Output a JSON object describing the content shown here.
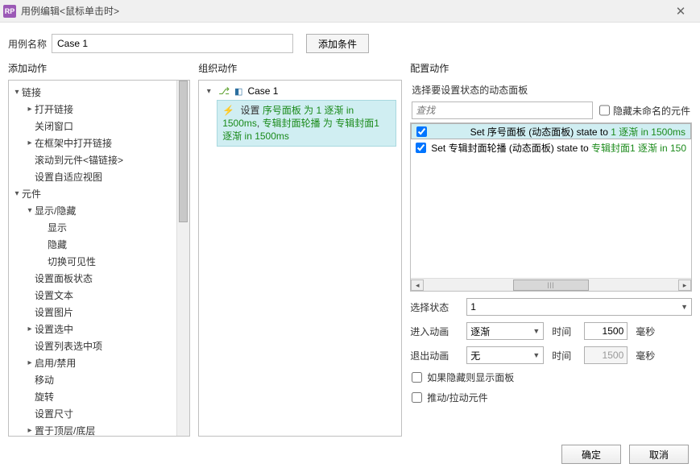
{
  "window": {
    "title": "用例编辑<鼠标单击时>"
  },
  "top": {
    "label": "用例名称",
    "case_name": "Case 1",
    "add_condition": "添加条件"
  },
  "columns": {
    "left": "添加动作",
    "mid": "组织动作",
    "right": "配置动作"
  },
  "tree": [
    {
      "level": 0,
      "arrow": "down",
      "label": "链接"
    },
    {
      "level": 1,
      "arrow": "right",
      "label": "打开链接"
    },
    {
      "level": 1,
      "arrow": "",
      "label": "关闭窗口"
    },
    {
      "level": 1,
      "arrow": "right",
      "label": "在框架中打开链接"
    },
    {
      "level": 1,
      "arrow": "",
      "label": "滚动到元件<锚链接>"
    },
    {
      "level": 1,
      "arrow": "",
      "label": "设置自适应视图"
    },
    {
      "level": 0,
      "arrow": "down",
      "label": "元件"
    },
    {
      "level": 1,
      "arrow": "down",
      "label": "显示/隐藏"
    },
    {
      "level": 2,
      "arrow": "",
      "label": "显示"
    },
    {
      "level": 2,
      "arrow": "",
      "label": "隐藏"
    },
    {
      "level": 2,
      "arrow": "",
      "label": "切换可见性"
    },
    {
      "level": 1,
      "arrow": "",
      "label": "设置面板状态"
    },
    {
      "level": 1,
      "arrow": "",
      "label": "设置文本"
    },
    {
      "level": 1,
      "arrow": "",
      "label": "设置图片"
    },
    {
      "level": 1,
      "arrow": "right",
      "label": "设置选中"
    },
    {
      "level": 1,
      "arrow": "",
      "label": "设置列表选中项"
    },
    {
      "level": 1,
      "arrow": "right",
      "label": "启用/禁用"
    },
    {
      "level": 1,
      "arrow": "",
      "label": "移动"
    },
    {
      "level": 1,
      "arrow": "",
      "label": "旋转"
    },
    {
      "level": 1,
      "arrow": "",
      "label": "设置尺寸"
    },
    {
      "level": 1,
      "arrow": "right",
      "label": "置于顶层/底层"
    }
  ],
  "mid": {
    "case_label": "Case 1",
    "action": {
      "prefix": "设置 ",
      "p1": "序号面板 为 1 逐渐 in 1500ms",
      "sep": ", ",
      "p2": "专辑封面轮播 为 专辑封面1 逐渐 in 1500ms"
    }
  },
  "right": {
    "pick_label": "选择要设置状态的动态面板",
    "search_placeholder": "查找",
    "hide_unnamed": "隐藏未命名的元件",
    "list": [
      {
        "checked": true,
        "selected": true,
        "pre": "Set 序号面板 (动态面板) state to ",
        "green": "1 逐渐 in 1500ms"
      },
      {
        "checked": true,
        "selected": false,
        "pre": "Set 专辑封面轮播 (动态面板) state to ",
        "green": "专辑封面1 逐渐 in 150"
      }
    ],
    "state_label": "选择状态",
    "state_value": "1",
    "anim_in_label": "进入动画",
    "anim_in_value": "逐渐",
    "anim_out_label": "退出动画",
    "anim_out_value": "无",
    "time_label": "时间",
    "time_in": "1500",
    "time_out": "1500",
    "ms": "毫秒",
    "chk_show": "如果隐藏则显示面板",
    "chk_push": "推动/拉动元件"
  },
  "footer": {
    "ok": "确定",
    "cancel": "取消"
  }
}
